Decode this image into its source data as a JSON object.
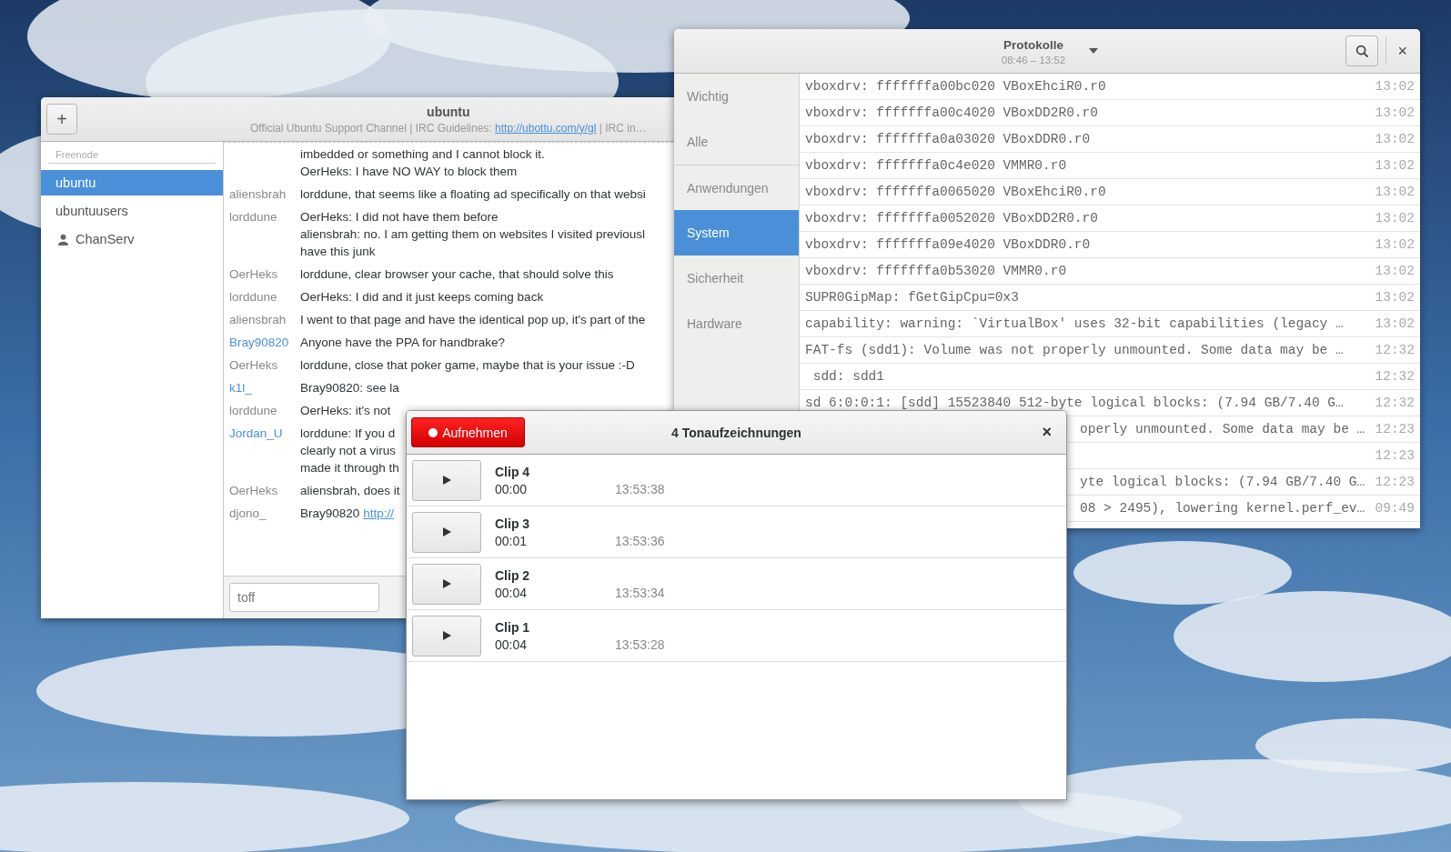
{
  "chat_window": {
    "title": "ubuntu",
    "topic_start": "Official Ubuntu Support Channel | IRC Guidelines: ",
    "topic_link": "http://ubottu.com/y/gl",
    "topic_end": " | IRC in…",
    "add_button": "+",
    "sidebar": {
      "network": "Freenode",
      "items": [
        {
          "label": "ubuntu",
          "kind": "channel",
          "selected": true
        },
        {
          "label": "ubuntuusers",
          "kind": "channel",
          "selected": false
        },
        {
          "label": "ChanServ",
          "kind": "user",
          "selected": false
        }
      ]
    },
    "messages": [
      {
        "lines": [
          "imbedded or something and I cannot block it.",
          "OerHeks: I have NO WAY to block them"
        ]
      },
      {
        "nick": "aliensbrah",
        "color": "#888a85",
        "lines": [
          "lorddune, that seems like a floating ad specifically on that websi"
        ]
      },
      {
        "nick": "lorddune",
        "color": "#888a85",
        "lines": [
          "OerHeks: I did not have them before",
          "aliensbrah: no. I am getting them on websites I visited previousl",
          "have this junk"
        ]
      },
      {
        "nick": "OerHeks",
        "color": "#888a85",
        "lines": [
          "lorddune, clear browser your cache, that should solve this"
        ]
      },
      {
        "nick": "lorddune",
        "color": "#888a85",
        "lines": [
          "OerHeks: I did and it just keeps coming back"
        ]
      },
      {
        "nick": "aliensbrah",
        "color": "#888a85",
        "lines": [
          "I went to that page and have the identical pop up, it's part of the"
        ]
      },
      {
        "nick": "Bray90820",
        "color": "#4a90d9",
        "lines": [
          "Anyone have the PPA for handbrake?"
        ]
      },
      {
        "nick": "OerHeks",
        "color": "#888a85",
        "lines": [
          "lorddune, close that poker game, maybe that is your issue :-D"
        ]
      },
      {
        "nick": "k1l_",
        "color": "#4a90d9",
        "lines": [
          "Bray90820: see la"
        ]
      },
      {
        "nick": "lorddune",
        "color": "#888a85",
        "lines": [
          "OerHeks: it's not"
        ]
      },
      {
        "nick": "Jordan_U",
        "color": "#4a90d9",
        "lines": [
          "lorddune: If you d",
          "clearly not a virus",
          "made it through th"
        ]
      },
      {
        "nick": "OerHeks",
        "color": "#888a85",
        "lines": [
          "aliensbrah, does it"
        ]
      },
      {
        "nick": "djono_",
        "color": "#888a85",
        "lines": [
          "Bray90820"
        ],
        "link": "http://"
      }
    ],
    "entry": {
      "value": "toff"
    }
  },
  "log_window": {
    "title": "Protokolle",
    "subtitle": "08:46 – 13:52",
    "close": "×",
    "categories": [
      {
        "label": "Wichtig",
        "selected": false
      },
      {
        "label": "Alle",
        "selected": false
      },
      {
        "label": "Anwendungen",
        "selected": false
      },
      {
        "label": "System",
        "selected": true
      },
      {
        "label": "Sicherheit",
        "selected": false
      },
      {
        "label": "Hardware",
        "selected": false
      }
    ],
    "rows": [
      {
        "kind": "full",
        "message": "vboxdrv: fffffffa00bc020 VBoxEhciR0.r0",
        "time": "13:02"
      },
      {
        "kind": "full",
        "message": "vboxdrv: fffffffa00c4020 VBoxDD2R0.r0",
        "time": "13:02"
      },
      {
        "kind": "full",
        "message": "vboxdrv: fffffffa0a03020 VBoxDDR0.r0",
        "time": "13:02"
      },
      {
        "kind": "full",
        "message": "vboxdrv: fffffffa0c4e020 VMMR0.r0",
        "time": "13:02"
      },
      {
        "kind": "full",
        "message": "vboxdrv: fffffffa0065020 VBoxEhciR0.r0",
        "time": "13:02"
      },
      {
        "kind": "full",
        "message": "vboxdrv: fffffffa0052020 VBoxDD2R0.r0",
        "time": "13:02"
      },
      {
        "kind": "full",
        "message": "vboxdrv: fffffffa09e4020 VBoxDDR0.r0",
        "time": "13:02"
      },
      {
        "kind": "full",
        "message": "vboxdrv: fffffffa0b53020 VMMR0.r0",
        "time": "13:02"
      },
      {
        "kind": "full",
        "message": "SUPR0GipMap: fGetGipCpu=0x3",
        "time": "13:02"
      },
      {
        "kind": "full",
        "message": "capability: warning: `VirtualBox' uses 32-bit capabilities (legacy …",
        "time": "13:02"
      },
      {
        "kind": "full",
        "message": "FAT-fs (sdd1): Volume was not properly unmounted. Some data may be …",
        "time": "12:32"
      },
      {
        "kind": "full",
        "message": " sdd: sdd1",
        "time": "12:32"
      },
      {
        "kind": "full",
        "message": "sd 6:0:0:1: [sdd] 15523840 512-byte logical blocks: (7.94 GB/7.40 G…",
        "time": "12:32"
      },
      {
        "kind": "partial",
        "message": "operly unmounted. Some data may be …",
        "time": "12:23"
      },
      {
        "kind": "partial",
        "time": "12:23"
      },
      {
        "kind": "partial",
        "message": "yte logical blocks: (7.94 GB/7.40 G…",
        "time": "12:23"
      },
      {
        "kind": "partial",
        "message": "08 > 2495), lowering kernel.perf_ev…",
        "time": "09:49"
      }
    ]
  },
  "recorder_window": {
    "record_button": "Aufnehmen",
    "title": "4 Tonaufzeichnungen",
    "close": "×",
    "clips": [
      {
        "name": "Clip 4",
        "duration": "00:00",
        "time": "13:53:38"
      },
      {
        "name": "Clip 3",
        "duration": "00:01",
        "time": "13:53:36"
      },
      {
        "name": "Clip 2",
        "duration": "00:04",
        "time": "13:53:34"
      },
      {
        "name": "Clip 1",
        "duration": "00:04",
        "time": "13:53:28"
      }
    ]
  }
}
